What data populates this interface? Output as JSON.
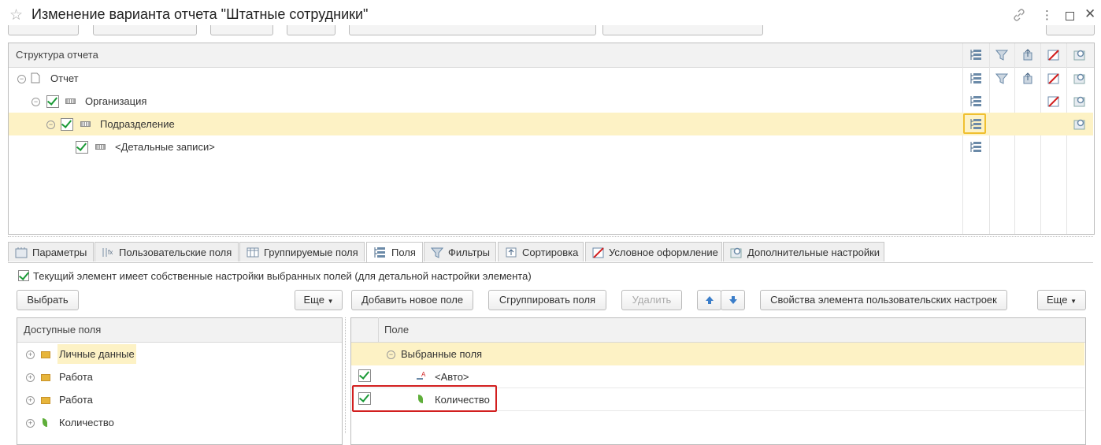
{
  "window": {
    "title": "Изменение варианта отчета \"Штатные сотрудники\"",
    "link_icon": "link-icon",
    "more_icon": "more-vertical-icon",
    "maximize_icon": "maximize-icon",
    "close_icon": "close-icon"
  },
  "structure": {
    "header": "Структура отчета",
    "rows": [
      {
        "label": "Отчет",
        "checked": false
      },
      {
        "label": "Организация",
        "checked": true
      },
      {
        "label": "Подразделение",
        "checked": true,
        "selected": true
      },
      {
        "label": "<Детальные записи>",
        "checked": true
      }
    ]
  },
  "tabs": [
    {
      "label": "Параметры",
      "icon": "parameters-icon"
    },
    {
      "label": "Пользовательские поля",
      "icon": "custom-fields-icon"
    },
    {
      "label": "Группируемые поля",
      "icon": "grouping-fields-icon"
    },
    {
      "label": "Поля",
      "icon": "fields-icon",
      "active": true
    },
    {
      "label": "Фильтры",
      "icon": "filter-icon"
    },
    {
      "label": "Сортировка",
      "icon": "sort-icon"
    },
    {
      "label": "Условное оформление",
      "icon": "conditional-format-icon"
    },
    {
      "label": "Дополнительные настройки",
      "icon": "settings-icon"
    }
  ],
  "own_settings_checkbox": {
    "label": "Текущий элемент имеет собственные настройки выбранных полей (для детальной настройки элемента)",
    "checked": true
  },
  "left_toolbar": {
    "select": "Выбрать",
    "more": "Еще"
  },
  "right_toolbar": {
    "add_field": "Добавить новое поле",
    "group_fields": "Сгруппировать поля",
    "delete": "Удалить",
    "properties": "Свойства элемента пользовательских настроек",
    "more": "Еще"
  },
  "available_fields": {
    "header": "Доступные поля",
    "items": [
      {
        "label": "Личные данные",
        "type": "folder",
        "highlighted": true
      },
      {
        "label": "Работа",
        "type": "folder"
      },
      {
        "label": "Работа",
        "type": "folder"
      },
      {
        "label": "Количество",
        "type": "resource"
      }
    ]
  },
  "selected_fields": {
    "header": "Поле",
    "group": "Выбранные поля",
    "items": [
      {
        "label": "<Авто>",
        "checked": true
      },
      {
        "label": "Количество",
        "checked": true,
        "boxed": true
      }
    ]
  },
  "colors": {
    "selection": "#fdf2c5",
    "highlight_box": "#d21f1f",
    "check": "#1a9a36",
    "tab_border": "#c8c8c8"
  }
}
